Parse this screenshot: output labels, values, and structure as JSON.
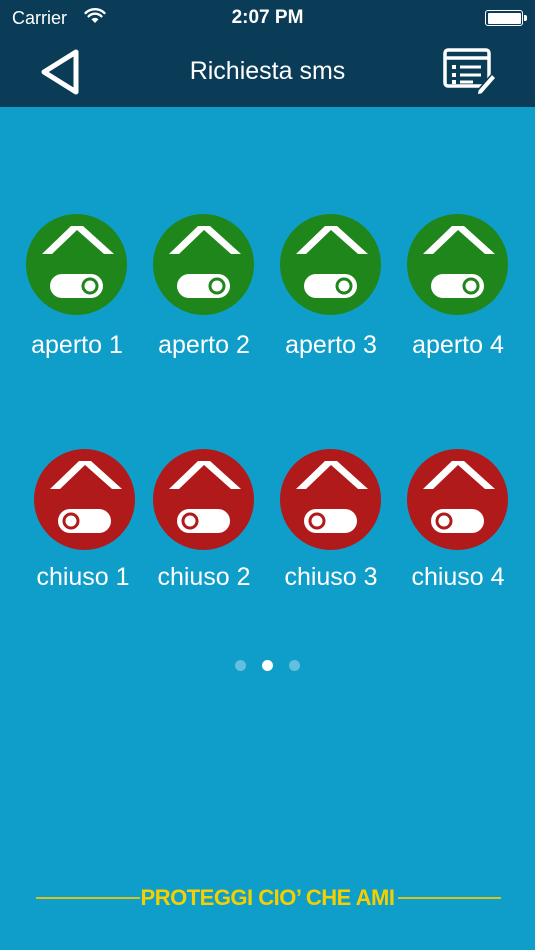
{
  "status_bar": {
    "carrier": "Carrier",
    "time": "2:07 PM"
  },
  "nav": {
    "title": "Richiesta sms",
    "back_icon": "triangle-back-icon",
    "menu_icon": "list-edit-icon"
  },
  "colors": {
    "background": "#0f9ec9",
    "header": "#0a3c57",
    "open": "#1f861c",
    "closed": "#b01a1a",
    "footer": "#f5d000"
  },
  "open_buttons": [
    {
      "label": "aperto 1"
    },
    {
      "label": "aperto 2"
    },
    {
      "label": "aperto 3"
    },
    {
      "label": "aperto 4"
    }
  ],
  "closed_buttons": [
    {
      "label": "chiuso 1"
    },
    {
      "label": "chiuso 2"
    },
    {
      "label": "chiuso 3"
    },
    {
      "label": "chiuso 4"
    }
  ],
  "pager": {
    "count": 3,
    "active": 1
  },
  "footer": {
    "slogan": "PROTEGGI CIO’ CHE AMI"
  }
}
